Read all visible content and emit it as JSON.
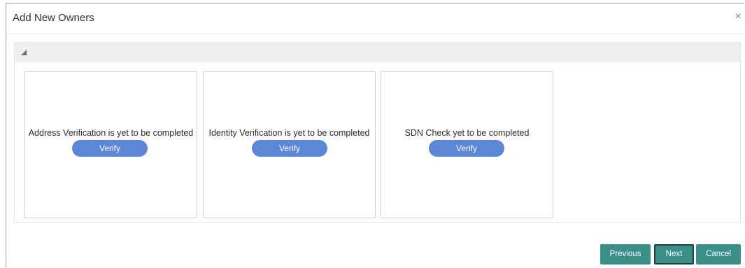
{
  "dialog": {
    "title": "Add New Owners",
    "close_glyph": "×"
  },
  "section": {
    "toggle_icon": "collapse-triangle-icon"
  },
  "cards": [
    {
      "message": "Address Verification is yet to be completed",
      "button_label": "Verify"
    },
    {
      "message": "Identity Verification is yet to be completed",
      "button_label": "Verify"
    },
    {
      "message": "SDN Check yet to be completed",
      "button_label": "Verify"
    }
  ],
  "footer": {
    "previous_label": "Previous",
    "next_label": "Next",
    "cancel_label": "Cancel"
  },
  "colors": {
    "verify_button": "#5b87d6",
    "footer_button": "#3a8f89",
    "section_bar": "#efefef"
  }
}
